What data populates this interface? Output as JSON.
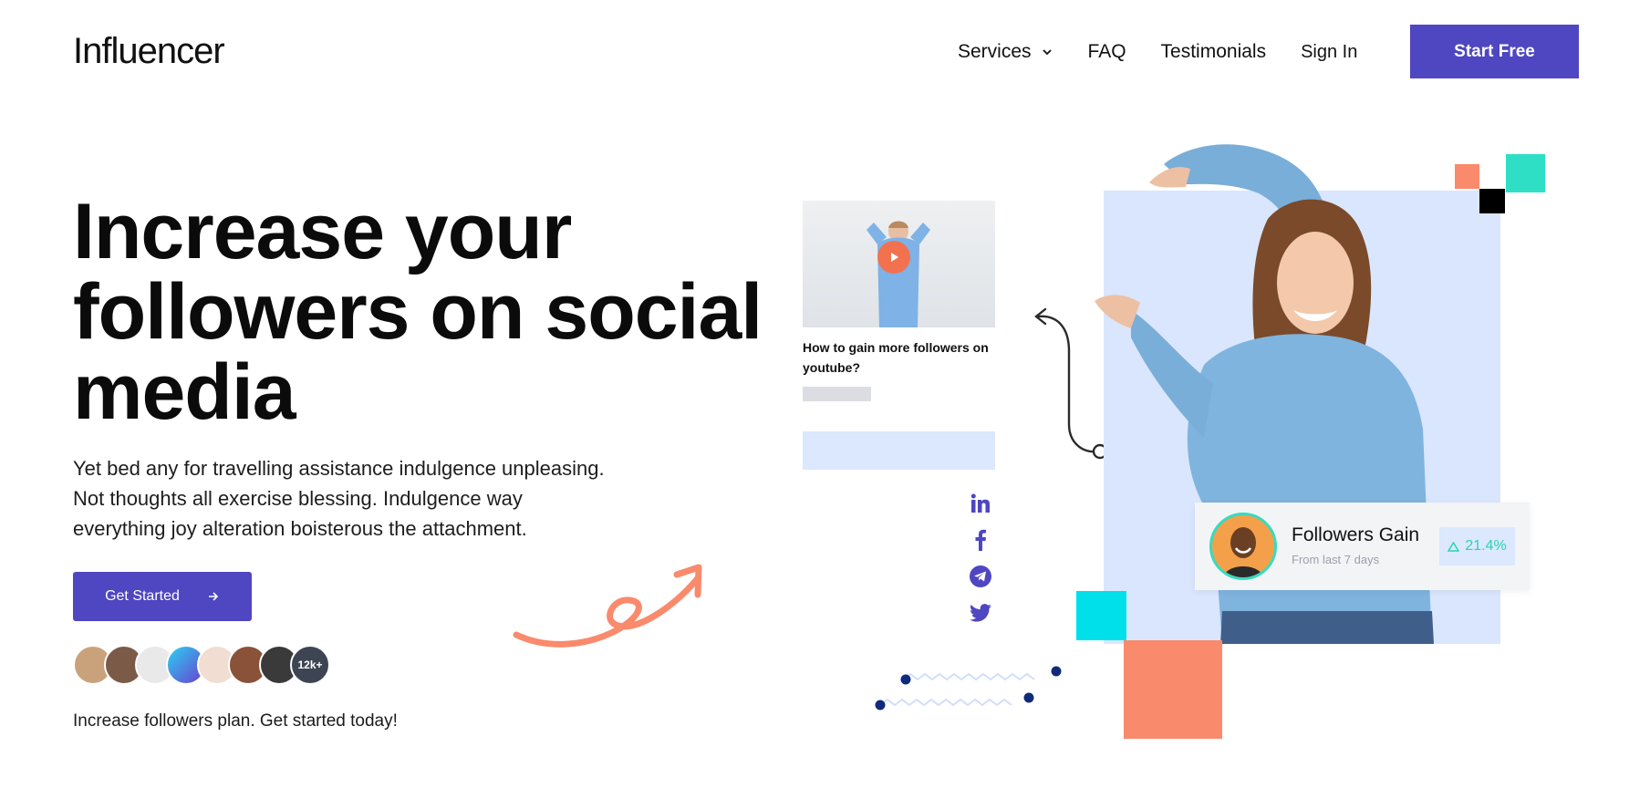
{
  "brand": {
    "logo": "Influencer"
  },
  "nav": {
    "items": [
      {
        "label": "Services"
      },
      {
        "label": "FAQ"
      },
      {
        "label": "Testimonials"
      }
    ],
    "signin_label": "Sign In",
    "cta_label": "Start Free"
  },
  "hero": {
    "title_line1": "Increase your",
    "title_line2": "followers on social",
    "title_line3": "media",
    "desc_line1": "Yet bed any for travelling assistance indulgence unpleasing.",
    "desc_line2": "Not thoughts all exercise blessing. Indulgence way",
    "desc_line3": "everything joy alteration boisterous the attachment.",
    "cta_label": "Get Started",
    "avatar_count": "12k+",
    "plan_text": "Increase followers plan. Get started today!"
  },
  "video_card": {
    "title": "How to gain more followers on youtube?"
  },
  "social_icons": [
    "linkedin-icon",
    "facebook-icon",
    "telegram-icon",
    "twitter-icon"
  ],
  "followers_card": {
    "title": "Followers Gain",
    "subtitle": "From last 7 days",
    "change": "21.4%"
  },
  "colors": {
    "primary": "#4f46c1",
    "accent_coral": "#f98a6c",
    "accent_teal": "#2edfc5",
    "accent_cyan": "#00e0ea",
    "light_blue": "#d9e6fd"
  }
}
